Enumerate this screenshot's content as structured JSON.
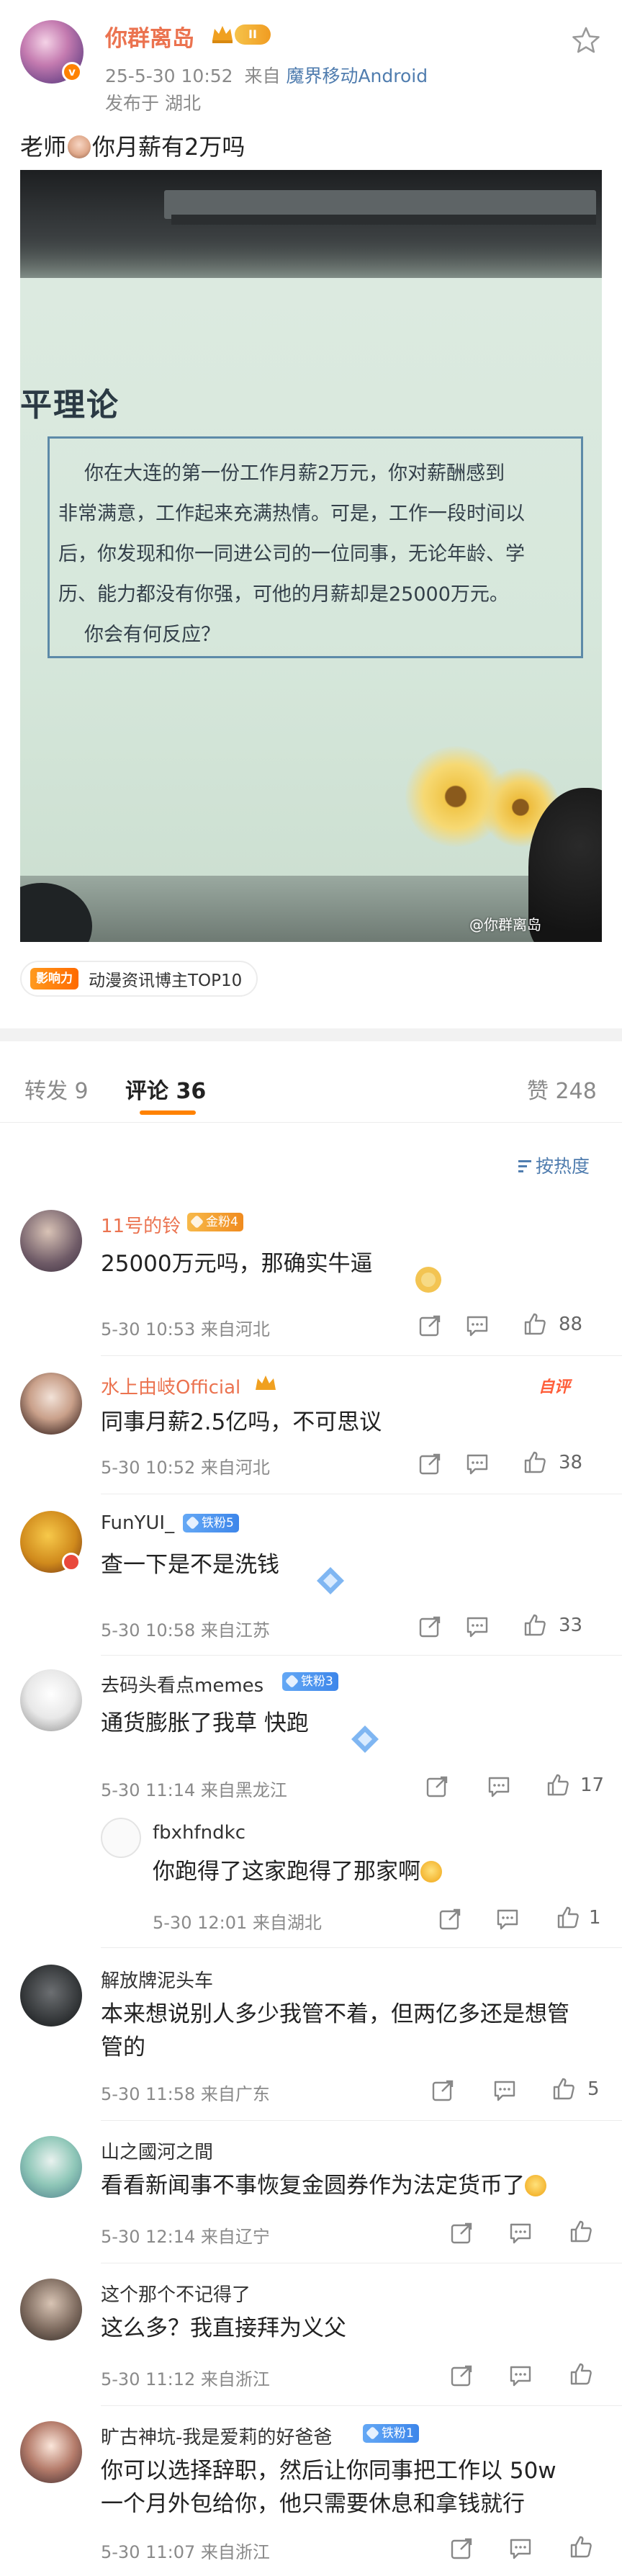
{
  "post": {
    "author": "你群离岛",
    "level_badge": "II",
    "time": "25-5-30 10:52",
    "from_label": "来自",
    "source": "魔界移动Android",
    "location": "发布于 湖北",
    "text_before_emoji": "老师",
    "text_after_emoji": "你月薪有2万吗",
    "image_watermark": "@你群离岛",
    "slide_title": "平理论",
    "slide_lines": [
      "你在大连的第一份工作月薪2万元，你对薪酬感到",
      "非常满意，工作起来充满热情。可是，工作一段时间以",
      "后，你发现和你一同进公司的一位同事，无论年龄、学",
      "历、能力都没有你强，可他的月薪却是25000万元。",
      "你会有何反应？"
    ],
    "influence_tag": "影响力",
    "influence_text": "动漫资讯博主TOP10"
  },
  "tabs": {
    "repost": "转发 9",
    "comments": "评论 36",
    "likes": "赞 248"
  },
  "sort_label": "按热度",
  "comments": [
    {
      "name": "11号的铃",
      "badge": "金粉4",
      "text": "25000万元吗，那确实牛逼",
      "meta": "5-30 10:53 来自河北",
      "likes": "88"
    },
    {
      "name": "水上由岐Official",
      "author_tag": "自评",
      "text": "同事月薪2.5亿吗，不可思议",
      "meta": "5-30 10:52 来自河北",
      "likes": "38"
    },
    {
      "name": "FunYUI_",
      "badge": "铁粉5",
      "text": "查一下是不是洗钱",
      "meta": "5-30 10:58 来自江苏",
      "likes": "33"
    },
    {
      "name": "去码头看点memes",
      "badge": "铁粉3",
      "text": "通货膨胀了我草 快跑",
      "meta": "5-30 11:14 来自黑龙江",
      "likes": "17"
    },
    {
      "name": "解放牌泥头车",
      "text_line1": "本来想说别人多少我管不着，但两亿多还是想管",
      "text_line2": "管的",
      "meta": "5-30 11:58 来自广东",
      "likes": "5"
    },
    {
      "name": "山之國河之間",
      "text": "看看新闻事不事恢复金圆券作为法定货币了",
      "meta": "5-30 12:14 来自辽宁",
      "likes": ""
    },
    {
      "name": "这个那个不记得了",
      "text": "这么多？我直接拜为义父",
      "meta": "5-30 11:12 来自浙江",
      "likes": ""
    },
    {
      "name": "旷古神坑-我是爱莉的好爸爸",
      "badge": "铁粉1",
      "text_line1": "你可以选择辞职，然后让你同事把工作以 50w",
      "text_line2": "一个月外包给你，他只需要休息和拿钱就行",
      "meta": "5-30 11:07 来自浙江",
      "likes": ""
    }
  ],
  "reply": {
    "name": "fbxhfndkc",
    "text": "你跑得了这家跑得了那家啊",
    "meta": "5-30 12:01 来自湖北",
    "likes": "1"
  },
  "colors": {
    "accent": "#ff8200",
    "name_orange": "#eb7350",
    "name_blue": "#4a6e99",
    "link_blue": "#507daf"
  }
}
